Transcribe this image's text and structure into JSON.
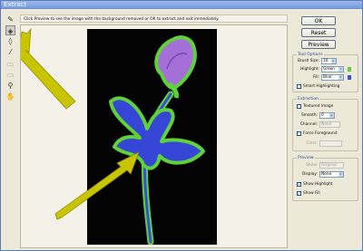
{
  "window": {
    "title": "Extract"
  },
  "info": {
    "text": "Click Preview to see the image with the background removed or OK to extract and exit immediately."
  },
  "buttons": {
    "ok": "OK",
    "reset": "Reset",
    "preview": "Preview"
  },
  "tool_options": {
    "title": "Tool Options",
    "brush_size_label": "Brush Size:",
    "brush_size_value": "10",
    "highlight_label": "Highlight:",
    "highlight_value": "Green",
    "fill_label": "Fill:",
    "fill_value": "Blue",
    "smart_highlighting_label": "Smart Highlighting",
    "smart_highlighting_checked": false
  },
  "extraction": {
    "title": "Extraction",
    "textured_image_label": "Textured Image",
    "textured_image_checked": false,
    "smooth_label": "Smooth:",
    "smooth_value": "0",
    "channel_label": "Channel:",
    "channel_value": "None",
    "force_foreground_label": "Force Foreground",
    "force_foreground_checked": false,
    "color_label": "Color:"
  },
  "preview": {
    "title": "Preview",
    "show_label": "Show:",
    "show_value": "Original",
    "display_label": "Display:",
    "display_value": "None",
    "show_highlight_label": "Show Highlight",
    "show_highlight_checked": true,
    "show_fill_label": "Show Fill",
    "show_fill_checked": true
  },
  "colors": {
    "highlight": "#5fd23a",
    "fill": "#3a4fd8",
    "accent": "#2a4da0",
    "arrow": "#c8c400"
  },
  "tools": [
    {
      "name": "edge-highlighter-icon",
      "glyph": "✎"
    },
    {
      "name": "fill-tool-icon",
      "glyph": "◈"
    },
    {
      "name": "eraser-icon",
      "glyph": "◊"
    },
    {
      "name": "eyedropper-icon",
      "glyph": "⁄"
    },
    {
      "name": "cleanup-tool-icon",
      "glyph": "▭"
    },
    {
      "name": "edge-touchup-icon",
      "glyph": "▭"
    },
    {
      "name": "zoom-icon",
      "glyph": "⚲"
    },
    {
      "name": "hand-icon",
      "glyph": "✋"
    }
  ]
}
